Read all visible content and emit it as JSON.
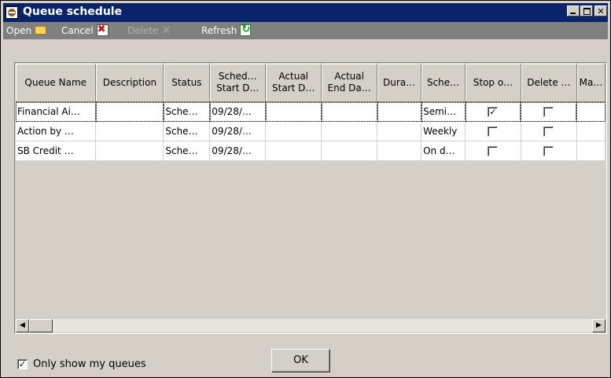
{
  "window": {
    "title": "Queue schedule",
    "icon": "app-icon"
  },
  "title_buttons": {
    "minimize": "_",
    "maximize": "□",
    "close": "✕"
  },
  "toolbar": {
    "open_label": "Open",
    "cancel_label": "Cancel",
    "delete_label": "Delete",
    "refresh_label": "Refresh"
  },
  "grid": {
    "columns": [
      {
        "l1": "Queue Name",
        "l2": ""
      },
      {
        "l1": "Description",
        "l2": ""
      },
      {
        "l1": "Status",
        "l2": ""
      },
      {
        "l1": "Sched…",
        "l2": "Start D…"
      },
      {
        "l1": "Actual",
        "l2": "Start D…"
      },
      {
        "l1": "Actual",
        "l2": "End Da…"
      },
      {
        "l1": "Dura…",
        "l2": ""
      },
      {
        "l1": "Sche…",
        "l2": ""
      },
      {
        "l1": "Stop o…",
        "l2": ""
      },
      {
        "l1": "Delete …",
        "l2": ""
      },
      {
        "l1": "Ma…",
        "l2": ""
      }
    ],
    "rows": [
      {
        "queue_name": "Financial Ai…",
        "description": "",
        "status": "Sche…",
        "sched_start": "09/28/…",
        "actual_start": "",
        "actual_end": "",
        "duration": "",
        "schedule": "Semi…",
        "stop_checked": true,
        "delete_checked": false
      },
      {
        "queue_name": "Action by …",
        "description": "",
        "status": "Sche…",
        "sched_start": "09/28/…",
        "actual_start": "",
        "actual_end": "",
        "duration": "",
        "schedule": "Weekly",
        "stop_checked": false,
        "delete_checked": false
      },
      {
        "queue_name": "SB Credit …",
        "description": "",
        "status": "Sche…",
        "sched_start": "09/28/…",
        "actual_start": "",
        "actual_end": "",
        "duration": "",
        "schedule": "On d…",
        "stop_checked": false,
        "delete_checked": false
      }
    ]
  },
  "footer": {
    "only_mine_label": "Only show my queues",
    "only_mine_checked": true,
    "ok_label": "OK"
  },
  "check_glyph": "✓"
}
